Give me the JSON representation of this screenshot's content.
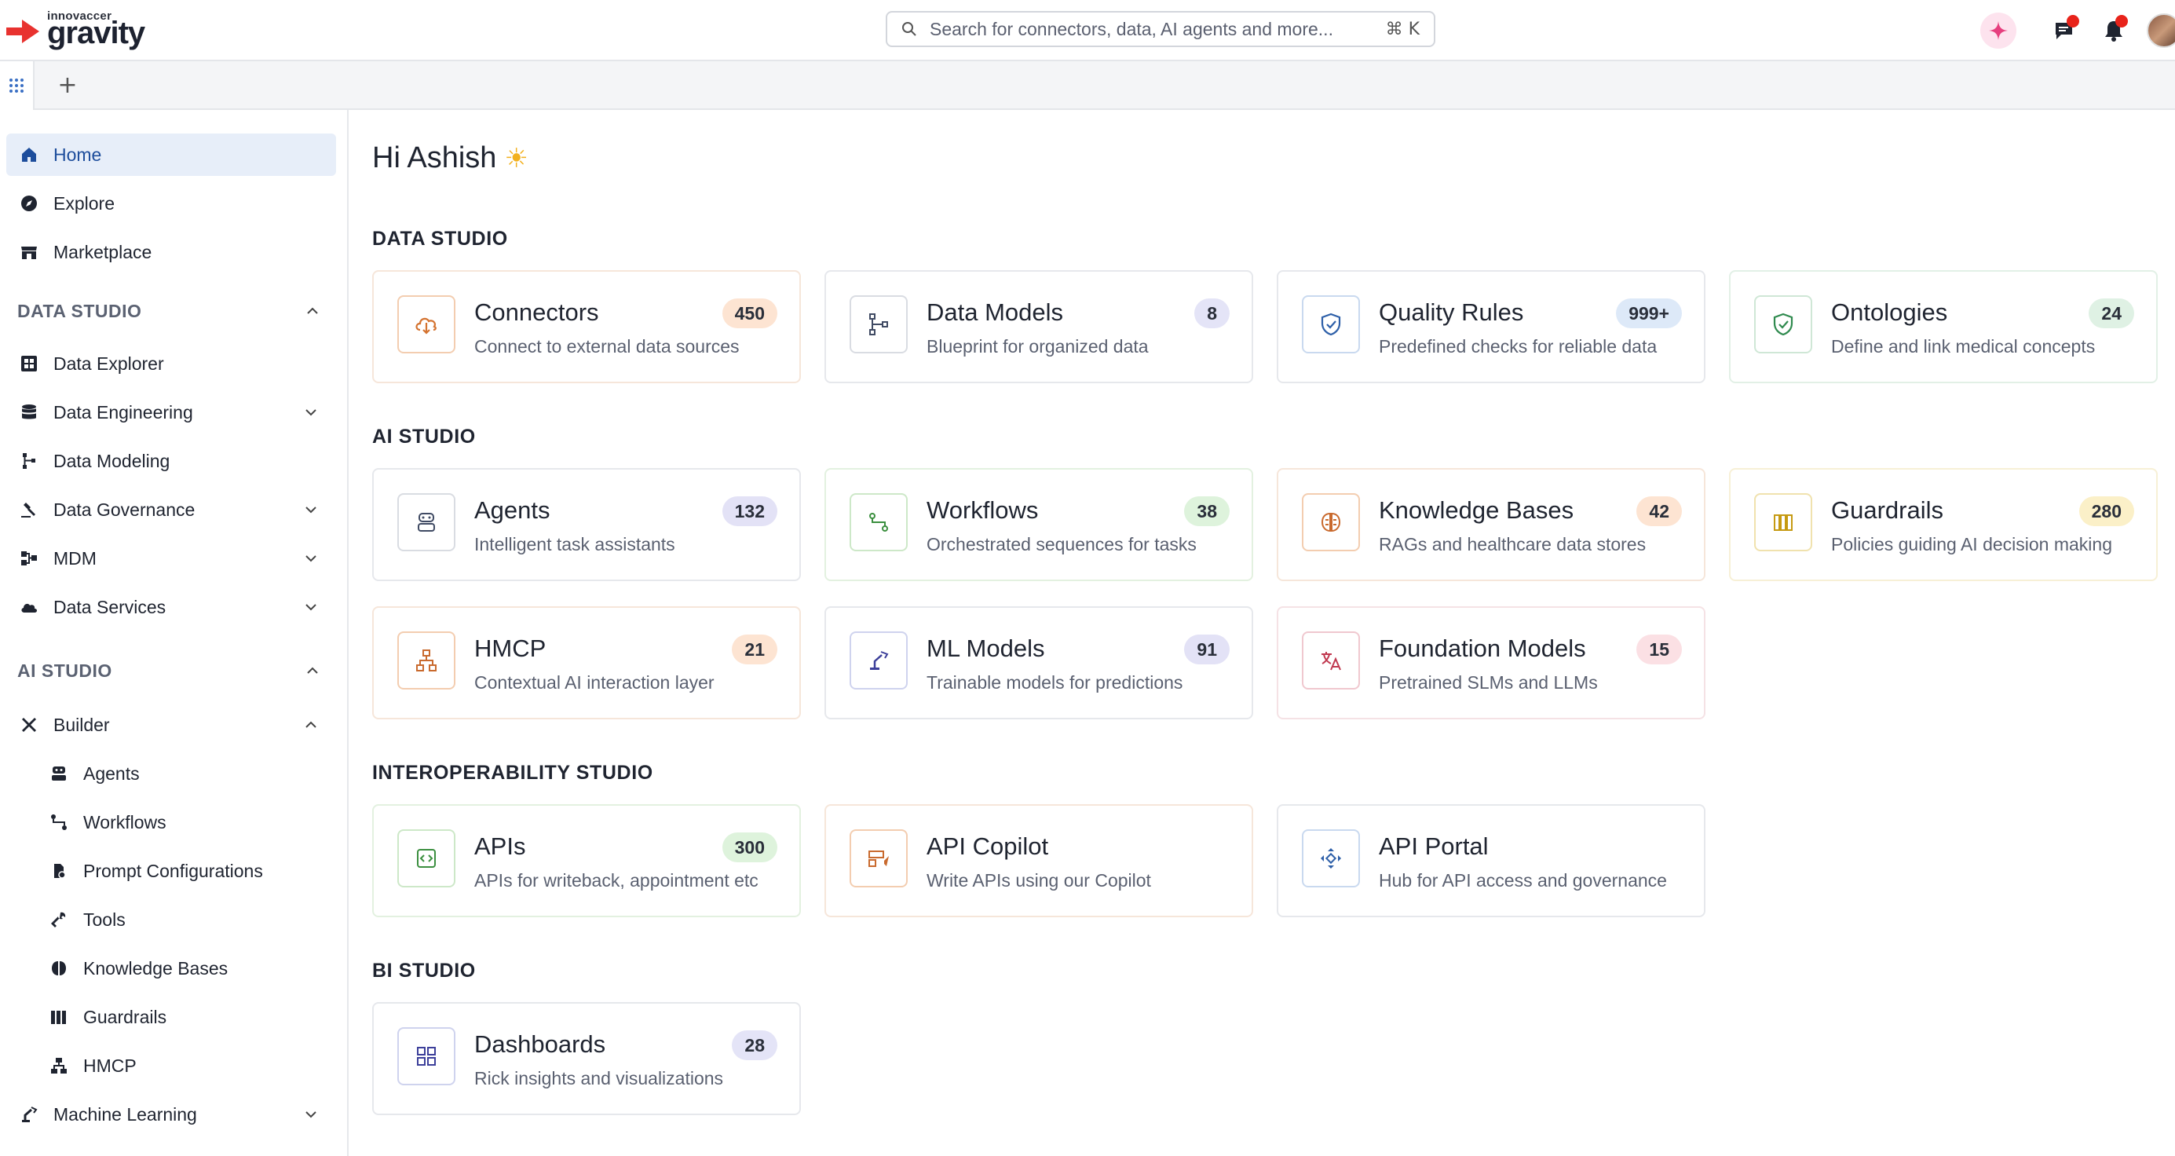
{
  "brand": {
    "small": "innovaccer",
    "big": "gravity"
  },
  "search": {
    "placeholder": "Search for connectors, data, AI agents and more...",
    "shortcut": "⌘ K"
  },
  "topbar": {
    "icons": [
      "sparkle-icon",
      "chat-icon",
      "bell-icon",
      "avatar"
    ]
  },
  "tabbar": {
    "plus": "+"
  },
  "sidebar": {
    "top_items": [
      {
        "label": "Home",
        "icon": "home-icon",
        "active": true
      },
      {
        "label": "Explore",
        "icon": "compass-icon"
      },
      {
        "label": "Marketplace",
        "icon": "store-icon"
      }
    ],
    "data_studio": {
      "title": "DATA STUDIO",
      "items": [
        {
          "label": "Data Explorer",
          "icon": "grid-icon"
        },
        {
          "label": "Data Engineering",
          "icon": "database-icon"
        },
        {
          "label": "Data Modeling",
          "icon": "model-icon"
        },
        {
          "label": "Data Governance",
          "icon": "gavel-icon"
        },
        {
          "label": "MDM",
          "icon": "mdm-icon"
        },
        {
          "label": "Data Services",
          "icon": "cloud-icon"
        }
      ]
    },
    "ai_studio": {
      "title": "AI STUDIO",
      "builder": "Builder",
      "sub_items": [
        {
          "label": "Agents",
          "icon": "agent-icon"
        },
        {
          "label": "Workflows",
          "icon": "workflow-icon"
        },
        {
          "label": "Prompt Configurations",
          "icon": "prompt-icon"
        },
        {
          "label": "Tools",
          "icon": "wrench-icon"
        },
        {
          "label": "Knowledge Bases",
          "icon": "brain-icon"
        },
        {
          "label": "Guardrails",
          "icon": "books-icon"
        },
        {
          "label": "HMCP",
          "icon": "hierarchy-icon"
        }
      ],
      "machine_learning": "Machine Learning"
    }
  },
  "main": {
    "greeting": "Hi Ashish",
    "greeting_emoji": "☀",
    "sections": {
      "data_studio": "DATA STUDIO",
      "ai_studio": "AI STUDIO",
      "interop_studio": "INTEROPERABILITY STUDIO",
      "bi_studio": "BI STUDIO"
    },
    "cards": {
      "connectors": {
        "title": "Connectors",
        "desc": "Connect to external data sources",
        "badge": "450",
        "badge_color": "#fde4d2"
      },
      "data_models": {
        "title": "Data Models",
        "desc": "Blueprint for organized data",
        "badge": "8",
        "badge_color": "#e4e4f7"
      },
      "quality_rules": {
        "title": "Quality Rules",
        "desc": "Predefined checks for reliable data",
        "badge": "999+",
        "badge_color": "#dde9f8"
      },
      "ontologies": {
        "title": "Ontologies",
        "desc": "Define and link medical concepts",
        "badge": "24",
        "badge_color": "#dff1e4"
      },
      "agents": {
        "title": "Agents",
        "desc": "Intelligent task assistants",
        "badge": "132",
        "badge_color": "#e3e2f6"
      },
      "workflows": {
        "title": "Workflows",
        "desc": "Orchestrated sequences for tasks",
        "badge": "38",
        "badge_color": "#def3dc"
      },
      "knowledge_bases": {
        "title": "Knowledge Bases",
        "desc": "RAGs and healthcare data stores",
        "badge": "42",
        "badge_color": "#fde4d2"
      },
      "guardrails": {
        "title": "Guardrails",
        "desc": "Policies guiding AI decision making",
        "badge": "280",
        "badge_color": "#fbf0c8"
      },
      "hmcp": {
        "title": "HMCP",
        "desc": "Contextual AI interaction layer",
        "badge": "21",
        "badge_color": "#fde4d2"
      },
      "ml_models": {
        "title": "ML Models",
        "desc": "Trainable models for predictions",
        "badge": "91",
        "badge_color": "#e3e2f6"
      },
      "foundation_models": {
        "title": "Foundation Models",
        "desc": "Pretrained SLMs and LLMs",
        "badge": "15",
        "badge_color": "#fbe0e4"
      },
      "apis": {
        "title": "APIs",
        "desc": "APIs for writeback, appointment etc",
        "badge": "300",
        "badge_color": "#def3dc"
      },
      "api_copilot": {
        "title": "API Copilot",
        "desc": "Write APIs using our Copilot"
      },
      "api_portal": {
        "title": "API Portal",
        "desc": "Hub for API access and governance"
      },
      "dashboards": {
        "title": "Dashboards",
        "desc": "Rick insights and visualizations",
        "badge": "28",
        "badge_color": "#e4e4f7"
      }
    }
  },
  "colors": {
    "accent_red": "#e8322f",
    "active_nav": "#e7eef9",
    "notification": "#e8231a"
  }
}
